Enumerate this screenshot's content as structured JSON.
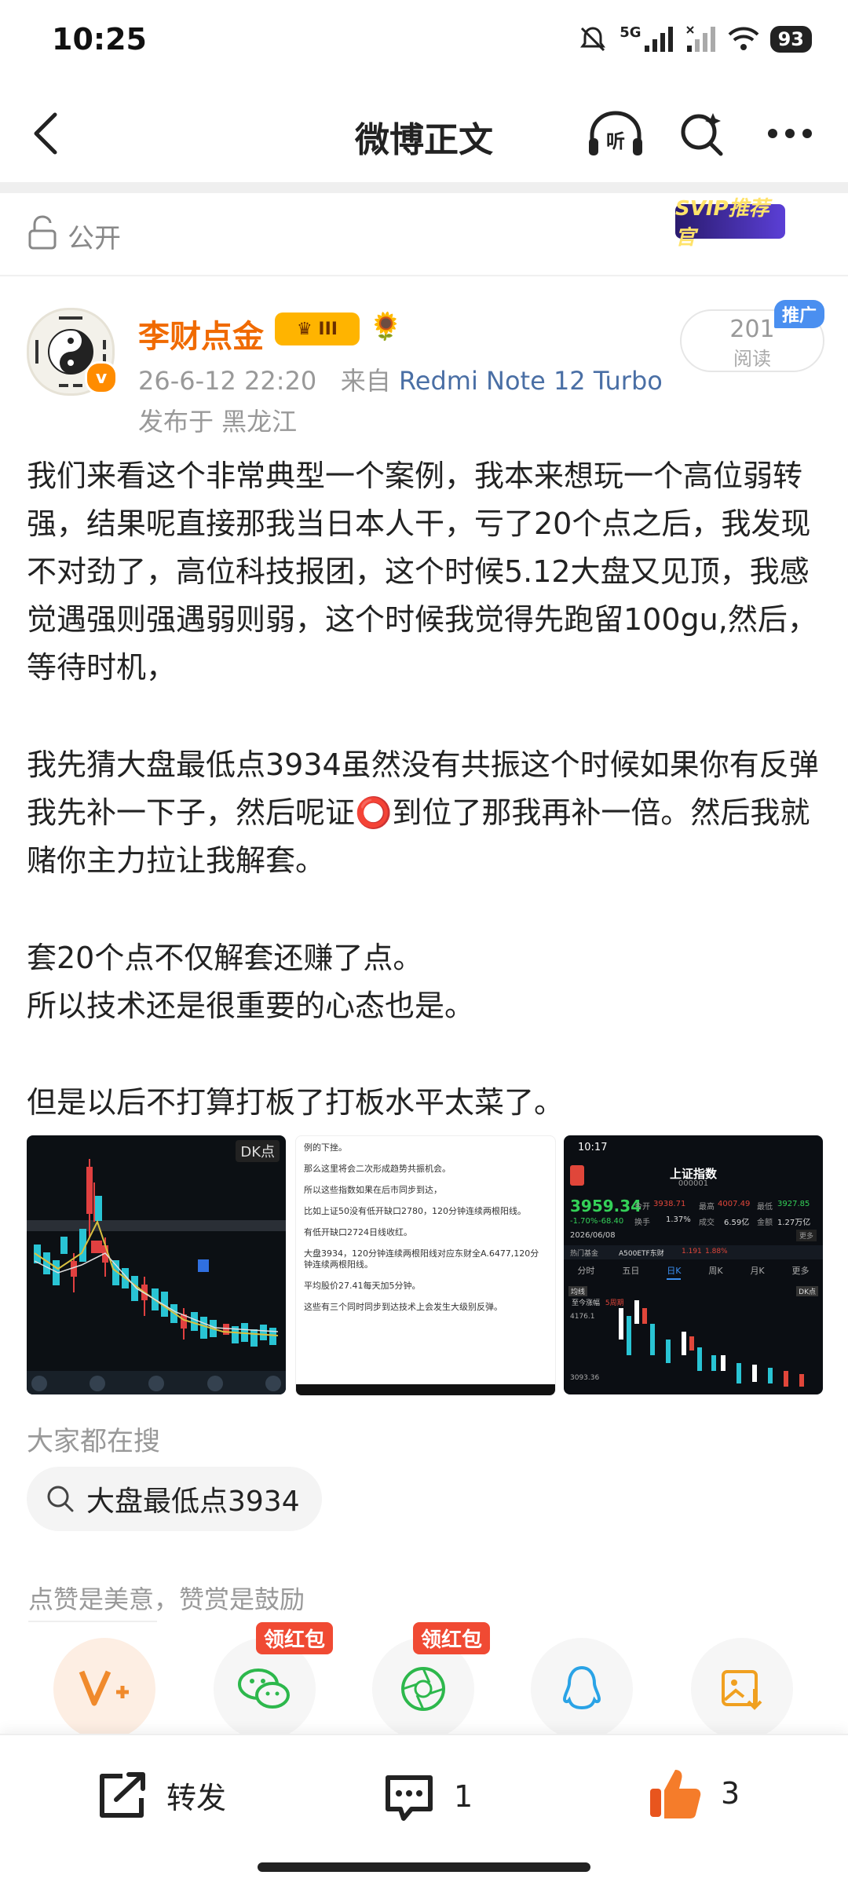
{
  "status": {
    "time": "10:25",
    "signal": "5G",
    "battery": "93"
  },
  "nav": {
    "title": "微博正文"
  },
  "visibility": {
    "label": "公开",
    "svip_badge": "SVIP推荐官"
  },
  "author": {
    "name": "李财点金",
    "level_badge": "III",
    "meta_date": "26-6-12 22:20",
    "meta_from": "来自",
    "device": "Redmi Note 12 Turbo",
    "location": "发布于 黑龙江",
    "reads_count": "201",
    "reads_label": "阅读",
    "promo": "推广",
    "verified": "v"
  },
  "post": {
    "paragraphs": [
      "我们来看这个非常典型一个案例，我本来想玩一个高位弱转强，结果呢直接那我当日本人干，亏了20个点之后，我发现不对劲了，高位科技报团，这个时候5.12大盘又见顶，我感觉遇强则强遇弱则弱，这个时候我觉得先跑留100gu,然后，等待时机，",
      "我先猜大盘最低点3934虽然没有共振这个时候如果你有反弹我先补一下子，然后呢证⭕到位了那我再补一倍。然后我就赌你主力拉让我解套。",
      "套20个点不仅解套还赚了点。",
      "所以技术还是很重要的心态也是。",
      "但是以后不打算打板了打板水平太菜了。"
    ]
  },
  "images": {
    "img1_tag": "DK点",
    "img2_lines": [
      "例的下挫。",
      "那么这里将会二次形成趋势共振机会。",
      "所以这些指数如果在后市同步到达，",
      "比如上证50没有低开缺口2780，120分钟连续两根阳线。",
      "有低开缺口2724日线收红。",
      "大盘3934，120分钟连续两根阳线对应东财全A.6477,120分钟连续两根阳线。",
      "平均股价27.41每天加5分钟。",
      "这些有三个同时同步到达技术上会发生大级别反弹。"
    ],
    "img3": {
      "time": "10:17",
      "title": "上证指数",
      "code": "000001",
      "price": "3959.34",
      "change": "-1.70%",
      "change_pts": "-68.40",
      "today_open_label": "今开",
      "today_open": "3938.71",
      "high_label": "最高",
      "high": "4007.49",
      "low_label": "最低",
      "low": "3927.85",
      "turnover_label": "换手",
      "turnover": "1.37%",
      "volume_label": "成交",
      "volume": "6.59亿",
      "amount_label": "金额",
      "amount": "1.27万亿",
      "date": "2026/06/08",
      "more": "更多",
      "tabs": [
        "分时",
        "五日",
        "日K",
        "周K",
        "月K",
        "更多"
      ],
      "fund_label": "热门基金",
      "fund_name": "A500ETF东财",
      "fund_val": "1.191",
      "fund_pct": "1.88%",
      "dk": "DK点",
      "axis_top": "4176.1",
      "axis_bottom": "3093.36",
      "chart_tag": "均线",
      "chart_note": "至今涨幅",
      "chart_note2": "5周期"
    }
  },
  "search": {
    "header": "大家都在搜",
    "chip": "大盘最低点3934"
  },
  "reward": {
    "text": "点赞是美意，赞赏是鼓励"
  },
  "share": {
    "redpack1": "领红包",
    "redpack2": "领红包"
  },
  "bottom": {
    "forward": "转发",
    "comments": "1",
    "likes": "3"
  }
}
